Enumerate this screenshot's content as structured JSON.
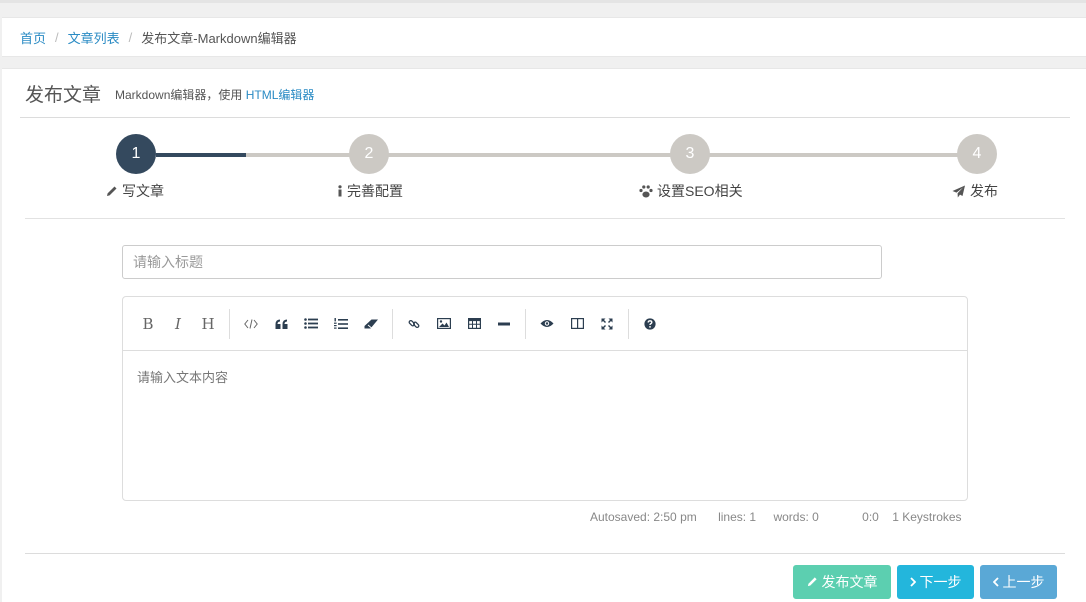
{
  "breadcrumb": {
    "home": "首页",
    "list": "文章列表",
    "current": "发布文章-Markdown编辑器",
    "separator": "/"
  },
  "header": {
    "title": "发布文章",
    "subtitle_prefix": "Markdown编辑器，使用",
    "subtitle_link": "HTML编辑器"
  },
  "steps": [
    {
      "number": "1",
      "label": "写文章",
      "icon": "pencil-icon",
      "active": true
    },
    {
      "number": "2",
      "label": "完善配置",
      "icon": "info-icon",
      "active": false
    },
    {
      "number": "3",
      "label": "设置SEO相关",
      "icon": "paw-icon",
      "active": false
    },
    {
      "number": "4",
      "label": "发布",
      "icon": "paper-plane-icon",
      "active": false
    }
  ],
  "form": {
    "title_placeholder": "请输入标题",
    "title_value": "",
    "content_placeholder": "请输入文本内容"
  },
  "toolbar": {
    "bold": "B",
    "italic": "I",
    "heading": "H",
    "icons": [
      "code-icon",
      "quote-icon",
      "unordered-list-icon",
      "ordered-list-icon",
      "eraser-icon",
      "link-icon",
      "image-icon",
      "table-icon",
      "horizontal-rule-icon",
      "preview-icon",
      "side-by-side-icon",
      "fullscreen-icon",
      "help-icon"
    ]
  },
  "status": {
    "autosaved": "Autosaved: 2:50 pm",
    "lines": "lines: 1",
    "words": "words: 0",
    "cursor": "0:0",
    "keystrokes": "1 Keystrokes"
  },
  "buttons": {
    "publish": "发布文章",
    "next": "下一步",
    "prev": "上一步"
  },
  "colors": {
    "active_step": "#34495e",
    "inactive_step": "#ccc9c4",
    "link": "#2a8bc4",
    "publish": "#5ccfb0",
    "next": "#23b6dc",
    "prev": "#5aa8d6"
  }
}
